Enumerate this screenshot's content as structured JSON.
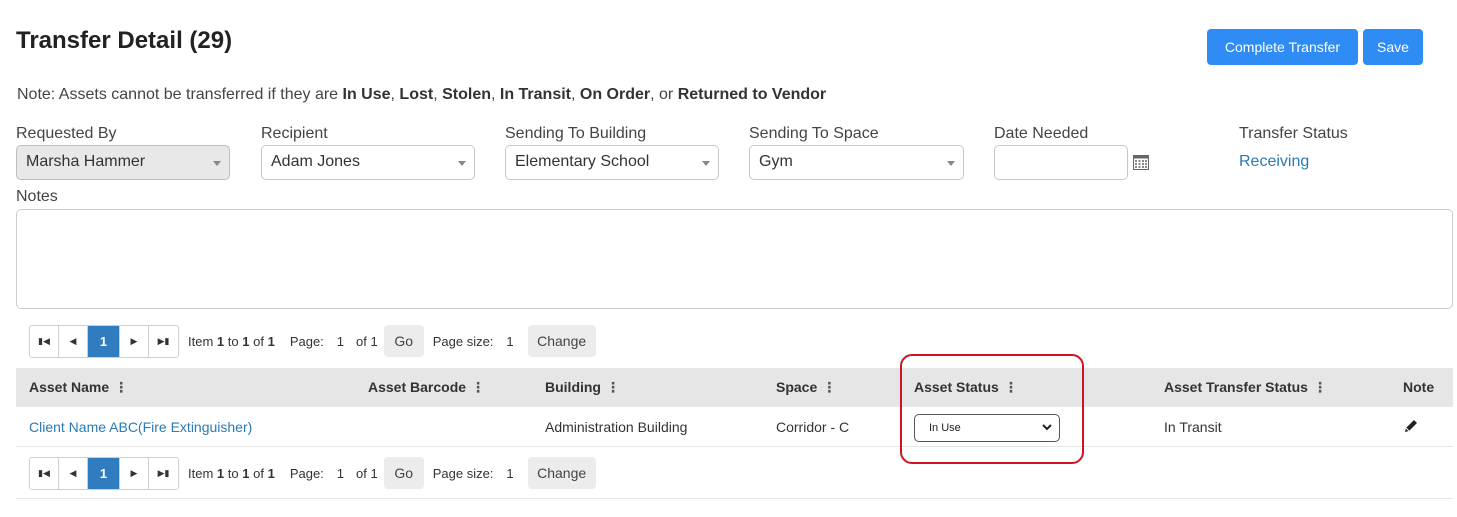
{
  "header": {
    "title": "Transfer Detail (29)",
    "complete_label": "Complete Transfer",
    "save_label": "Save"
  },
  "note": {
    "prefix": "Note: Assets cannot be transferred if they are ",
    "s1": "In Use",
    "sep1": ", ",
    "s2": "Lost",
    "sep2": ", ",
    "s3": "Stolen",
    "sep3": ", ",
    "s4": "In Transit",
    "sep4": ", ",
    "s5": "On Order",
    "sep5": ", or ",
    "s6": "Returned to Vendor"
  },
  "fields": {
    "requested_by": {
      "label": "Requested By",
      "value": "Marsha Hammer"
    },
    "recipient": {
      "label": "Recipient",
      "value": "Adam Jones"
    },
    "building": {
      "label": "Sending To Building",
      "value": "Elementary School"
    },
    "space": {
      "label": "Sending To Space",
      "value": "Gym"
    },
    "date_needed": {
      "label": "Date Needed",
      "value": ""
    },
    "transfer_status": {
      "label": "Transfer Status",
      "value": "Receiving"
    }
  },
  "notes": {
    "label": "Notes",
    "value": ""
  },
  "pager": {
    "current_page": "1",
    "item_word": "Item",
    "item_from": "1",
    "to_word": "to",
    "item_to": "1",
    "of_word": "of",
    "item_total": "1",
    "page_label": "Page:",
    "page_value": "1",
    "of_pages": "of 1",
    "go_label": "Go",
    "page_size_label": "Page size:",
    "page_size_value": "1",
    "change_label": "Change"
  },
  "table": {
    "columns": {
      "asset_name": "Asset Name",
      "asset_barcode": "Asset Barcode",
      "building": "Building",
      "space": "Space",
      "asset_status": "Asset Status",
      "asset_transfer_status": "Asset Transfer Status",
      "note": "Note"
    },
    "rows": [
      {
        "asset_name": "Client Name ABC(Fire Extinguisher)",
        "asset_barcode": "",
        "building": "Administration Building",
        "space": "Corridor - C",
        "asset_status": "In Use",
        "asset_transfer_status": "In Transit"
      }
    ]
  },
  "icons": {
    "calendar": "calendar-icon",
    "edit": "pencil-icon",
    "column_menu": "vertical-dots-icon"
  },
  "colors": {
    "primary": "#2f8cf5",
    "link": "#2a7ab4",
    "active_page": "#2f7cc1",
    "highlight": "#d0141e"
  }
}
